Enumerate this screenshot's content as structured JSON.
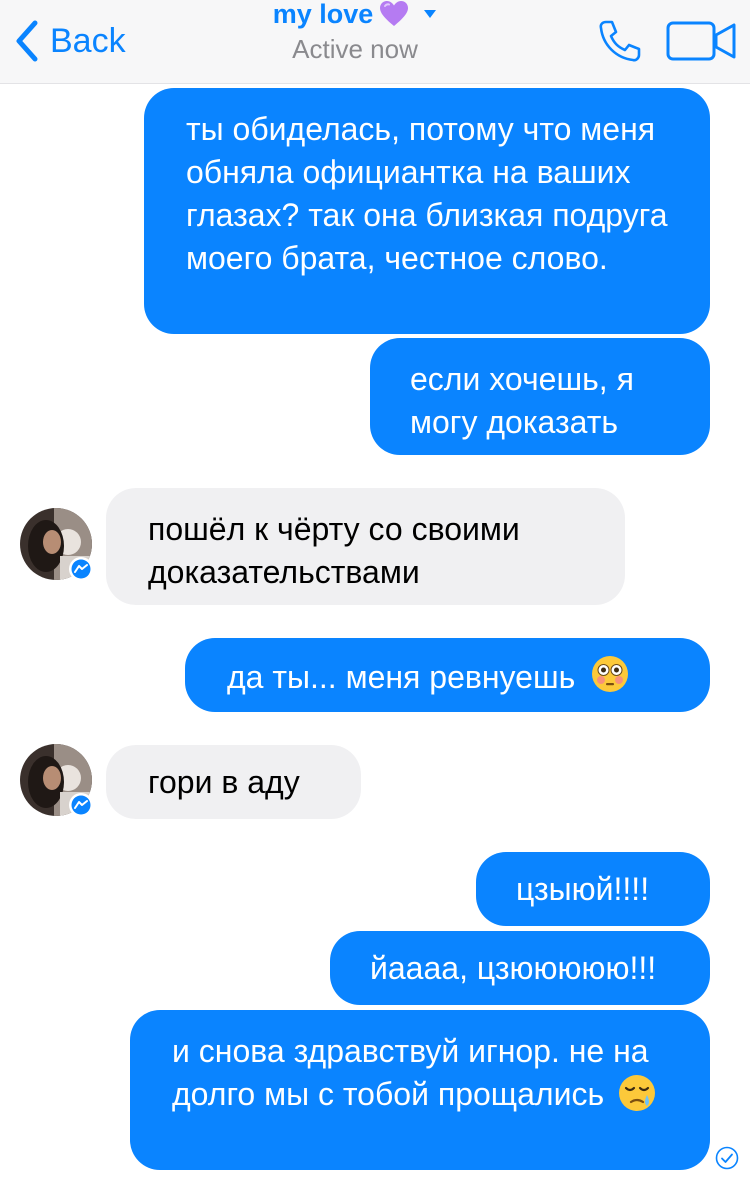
{
  "header": {
    "back_label": "Back",
    "contact_name": "my love",
    "status": "Active now",
    "heart_color": "#b57bf2",
    "accent_color": "#0a84ff"
  },
  "messages": [
    {
      "direction": "outgoing",
      "text": "ты обиделась, потому что меня обняла официантка на ваших глазах? так она близкая подруга моего брата, честное слово."
    },
    {
      "direction": "outgoing",
      "text": "если хочешь, я могу доказать"
    },
    {
      "direction": "incoming",
      "text": "пошёл к чёрту со своими доказательствами"
    },
    {
      "direction": "outgoing",
      "text": "да ты... меня ревнуешь",
      "emoji": "flushed-face"
    },
    {
      "direction": "incoming",
      "text": "гори в аду"
    },
    {
      "direction": "outgoing",
      "text": "цзыюй!!!!"
    },
    {
      "direction": "outgoing",
      "text": "йаааа, цзююююю!!!"
    },
    {
      "direction": "outgoing",
      "text": "и снова здравствуй игнор. не на долго мы с тобой прощались",
      "emoji": "sleepy-face"
    }
  ]
}
